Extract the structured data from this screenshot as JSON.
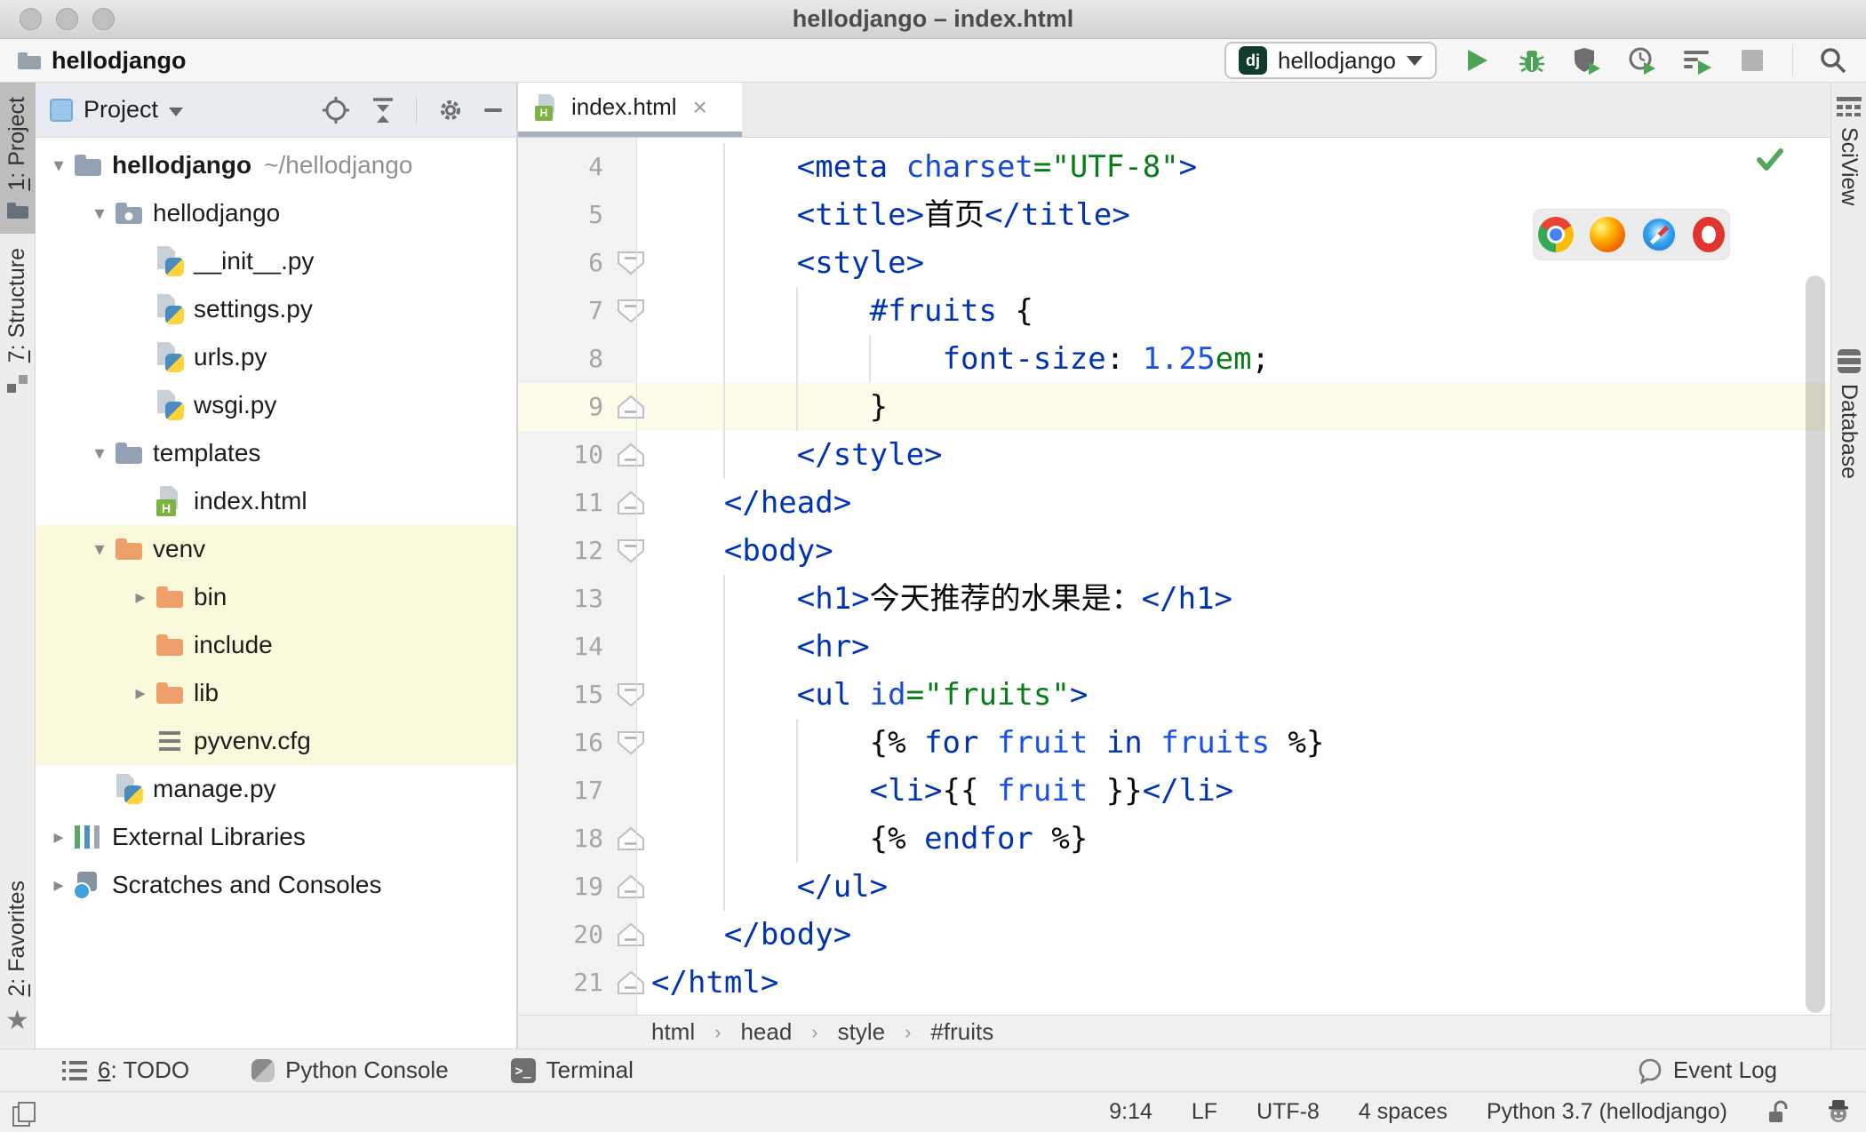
{
  "window": {
    "title": "hellodjango – index.html"
  },
  "toolbar": {
    "project_name": "hellodjango",
    "run_badge": "dj",
    "run_config": "hellodjango",
    "accent_green": "#4CA356",
    "icons": [
      "run-icon",
      "debug-icon",
      "run-with-coverage-icon",
      "profiler-icon",
      "run-concurrency-icon",
      "stop-icon",
      "search-everywhere-icon"
    ]
  },
  "left_bar": [
    {
      "label": "1: Project",
      "icon": "project-folder",
      "active": true
    },
    {
      "label": "7: Structure",
      "icon": "structure",
      "active": false
    },
    {
      "label": "2: Favorites",
      "icon": "star",
      "active": false
    }
  ],
  "right_bar": [
    {
      "label": "SciView",
      "icon": "sciview-grid"
    },
    {
      "label": "Database",
      "icon": "database"
    }
  ],
  "project_panel": {
    "header": {
      "title": "Project",
      "icons": [
        "locate-icon",
        "collapse-all-icon",
        "settings-gear-icon",
        "hide-icon"
      ]
    },
    "tree": [
      {
        "level": 0,
        "arrow": "open",
        "icon": "folder",
        "label": "hellodjango",
        "bold": true,
        "extra": "~/hellodjango"
      },
      {
        "level": 1,
        "arrow": "open",
        "icon": "folder-pkg",
        "label": "hellodjango"
      },
      {
        "level": 2,
        "arrow": null,
        "icon": "py",
        "label": "__init__.py"
      },
      {
        "level": 2,
        "arrow": null,
        "icon": "py",
        "label": "settings.py"
      },
      {
        "level": 2,
        "arrow": null,
        "icon": "py",
        "label": "urls.py"
      },
      {
        "level": 2,
        "arrow": null,
        "icon": "py",
        "label": "wsgi.py"
      },
      {
        "level": 1,
        "arrow": "open",
        "icon": "folder",
        "label": "templates"
      },
      {
        "level": 2,
        "arrow": null,
        "icon": "html",
        "label": "index.html"
      },
      {
        "level": 1,
        "arrow": "open",
        "icon": "folder-ex",
        "label": "venv",
        "yellow": true
      },
      {
        "level": 2,
        "arrow": "closed",
        "icon": "folder-ex",
        "label": "bin",
        "yellow": true
      },
      {
        "level": 2,
        "arrow": null,
        "icon": "folder-ex",
        "label": "include",
        "yellow": true
      },
      {
        "level": 2,
        "arrow": "closed",
        "icon": "folder-ex",
        "label": "lib",
        "yellow": true
      },
      {
        "level": 2,
        "arrow": null,
        "icon": "cfg",
        "label": "pyvenv.cfg",
        "yellow": true
      },
      {
        "level": 1,
        "arrow": null,
        "icon": "py",
        "label": "manage.py"
      },
      {
        "level": 0,
        "arrow": "closed",
        "icon": "libs",
        "label": "External Libraries"
      },
      {
        "level": 0,
        "arrow": "closed",
        "icon": "scratches",
        "label": "Scratches and Consoles"
      }
    ]
  },
  "editor": {
    "tab": {
      "label": "index.html"
    },
    "caret_line_color": "#FCFAE8",
    "browser_popup": [
      "chrome",
      "firefox",
      "safari",
      "opera"
    ],
    "breadcrumbs": [
      "html",
      "head",
      "style",
      "#fruits"
    ],
    "lines": [
      {
        "num": 4,
        "indent": 8,
        "fold": null,
        "hl": false,
        "tokens": [
          [
            "tag",
            "<meta "
          ],
          [
            "attr",
            "charset"
          ],
          [
            "str",
            "=\"UTF-8\""
          ],
          [
            "tag",
            ">"
          ]
        ]
      },
      {
        "num": 5,
        "indent": 8,
        "fold": null,
        "hl": false,
        "tokens": [
          [
            "tag",
            "<title>"
          ],
          [
            "plain",
            "首页"
          ],
          [
            "tag",
            "</title>"
          ]
        ]
      },
      {
        "num": 6,
        "indent": 8,
        "fold": "start",
        "hl": false,
        "tokens": [
          [
            "tag",
            "<style>"
          ]
        ]
      },
      {
        "num": 7,
        "indent": 12,
        "fold": "start",
        "hl": false,
        "tokens": [
          [
            "tag",
            "#fruits"
          ],
          [
            "plain",
            " {"
          ]
        ]
      },
      {
        "num": 8,
        "indent": 16,
        "fold": null,
        "hl": false,
        "tokens": [
          [
            "tag",
            "font-size"
          ],
          [
            "plain",
            ": "
          ],
          [
            "num",
            "1.25"
          ],
          [
            "str",
            "em"
          ],
          [
            "plain",
            ";"
          ]
        ]
      },
      {
        "num": 9,
        "indent": 12,
        "fold": "end",
        "hl": true,
        "tokens": [
          [
            "plain",
            "}"
          ]
        ]
      },
      {
        "num": 10,
        "indent": 8,
        "fold": "end",
        "hl": false,
        "tokens": [
          [
            "tag",
            "</style>"
          ]
        ]
      },
      {
        "num": 11,
        "indent": 4,
        "fold": "end",
        "hl": false,
        "tokens": [
          [
            "tag",
            "</head>"
          ]
        ]
      },
      {
        "num": 12,
        "indent": 4,
        "fold": "start",
        "hl": false,
        "tokens": [
          [
            "tag",
            "<body>"
          ]
        ]
      },
      {
        "num": 13,
        "indent": 8,
        "fold": null,
        "hl": false,
        "tokens": [
          [
            "tag",
            "<h1>"
          ],
          [
            "plain",
            "今天推荐的水果是："
          ],
          [
            "tag",
            "</h1>"
          ]
        ]
      },
      {
        "num": 14,
        "indent": 8,
        "fold": null,
        "hl": false,
        "tokens": [
          [
            "tag",
            "<hr>"
          ]
        ]
      },
      {
        "num": 15,
        "indent": 8,
        "fold": "start",
        "hl": false,
        "tokens": [
          [
            "tag",
            "<ul "
          ],
          [
            "attr",
            "id"
          ],
          [
            "str",
            "=\"fruits\""
          ],
          [
            "tag",
            ">"
          ]
        ]
      },
      {
        "num": 16,
        "indent": 12,
        "fold": "start",
        "hl": false,
        "tokens": [
          [
            "plain",
            "{% "
          ],
          [
            "kw",
            "for"
          ],
          [
            "plain",
            " "
          ],
          [
            "var",
            "fruit"
          ],
          [
            "plain",
            " "
          ],
          [
            "kw",
            "in"
          ],
          [
            "plain",
            " "
          ],
          [
            "var",
            "fruits"
          ],
          [
            "plain",
            " %}"
          ]
        ]
      },
      {
        "num": 17,
        "indent": 12,
        "fold": null,
        "hl": false,
        "tokens": [
          [
            "tag",
            "<li>"
          ],
          [
            "plain",
            "{{ "
          ],
          [
            "var",
            "fruit"
          ],
          [
            "plain",
            " }}"
          ],
          [
            "tag",
            "</li>"
          ]
        ]
      },
      {
        "num": 18,
        "indent": 12,
        "fold": "end",
        "hl": false,
        "tokens": [
          [
            "plain",
            "{% "
          ],
          [
            "kw",
            "endfor"
          ],
          [
            "plain",
            " %}"
          ]
        ]
      },
      {
        "num": 19,
        "indent": 8,
        "fold": "end",
        "hl": false,
        "tokens": [
          [
            "tag",
            "</ul>"
          ]
        ]
      },
      {
        "num": 20,
        "indent": 4,
        "fold": "end",
        "hl": false,
        "tokens": [
          [
            "tag",
            "</body>"
          ]
        ]
      },
      {
        "num": 21,
        "indent": 0,
        "fold": "end",
        "hl": false,
        "tokens": [
          [
            "tag",
            "</html>"
          ]
        ]
      }
    ]
  },
  "bottom_bar": {
    "tools": [
      {
        "label": "6: TODO",
        "icon": "todo-list"
      },
      {
        "label": "Python Console",
        "icon": "python-console"
      },
      {
        "label": "Terminal",
        "icon": "terminal"
      }
    ],
    "event_log": "Event Log"
  },
  "status_bar": {
    "items": [
      "9:14",
      "LF",
      "UTF-8",
      "4 spaces",
      "Python 3.7 (hellodjango)"
    ]
  }
}
